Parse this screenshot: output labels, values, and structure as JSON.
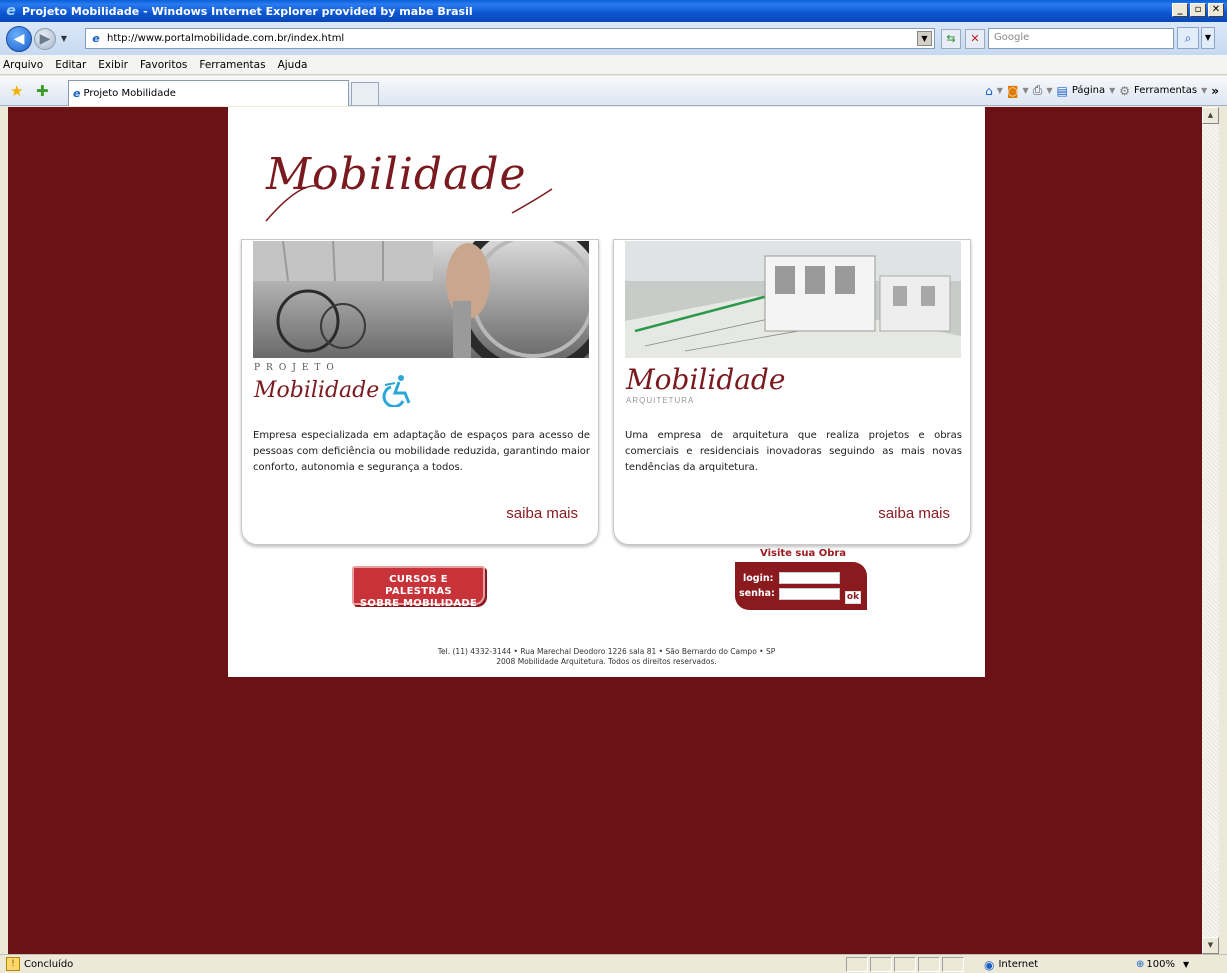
{
  "window": {
    "title": "Projeto Mobilidade - Windows Internet Explorer provided by mabe Brasil"
  },
  "address_bar": {
    "url": "http://www.portalmobilidade.com.br/index.html",
    "search_placeholder": "Google"
  },
  "menu": {
    "items": [
      "Arquivo",
      "Editar",
      "Exibir",
      "Favoritos",
      "Ferramentas",
      "Ajuda"
    ]
  },
  "tab": {
    "title": "Projeto Mobilidade"
  },
  "command_bar": {
    "page_label": "Página",
    "tools_label": "Ferramentas"
  },
  "page": {
    "logo": "Mobilidade",
    "cards": [
      {
        "brand_top": "PROJETO",
        "brand_script": "Mobilidade",
        "description": "Empresa especializada em adaptação de espaços para acesso de pessoas com deficiência ou mobilidade reduzida, garantindo maior conforto, autonomia e segurança a todos.",
        "link": "saiba mais"
      },
      {
        "brand_script": "Mobilidade",
        "brand_sub": "ARQUITETURA",
        "description": "Uma empresa de arquitetura que realiza projetos e obras comerciais e residenciais inovadoras seguindo as mais novas tendências da arquitetura.",
        "link": "saiba mais"
      }
    ],
    "courses_line1": "CURSOS E PALESTRAS",
    "courses_line2": "SOBRE MOBILIDADE",
    "visit_title": "Visite sua Obra",
    "login_label": "login:",
    "password_label": "senha:",
    "ok_label": "ok",
    "footer_line1": "Tel. (11) 4332-3144 • Rua Marechal Deodoro 1226 sala 81 • São Bernardo do Campo • SP",
    "footer_line2": "2008 Mobilidade Arquitetura. Todos os direitos reservados."
  },
  "status_bar": {
    "status": "Concluído",
    "zone": "Internet",
    "zoom": "100%"
  },
  "colors": {
    "page_background": "#6b1217",
    "brand": "#7a1a1e",
    "accent": "#8a1a1e"
  }
}
